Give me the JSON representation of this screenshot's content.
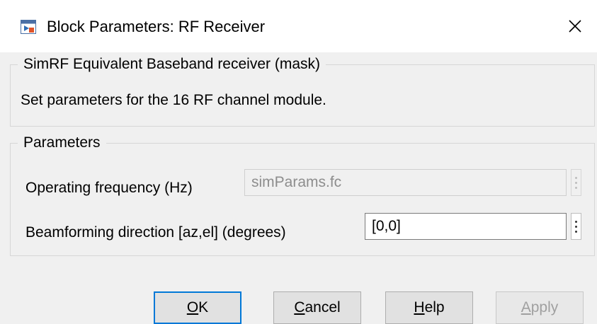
{
  "window": {
    "title": "Block Parameters: RF Receiver",
    "icon": "simulink-block-icon",
    "close_icon": "close-icon"
  },
  "mask": {
    "legend": "SimRF Equivalent Baseband receiver (mask)",
    "description": "Set parameters for the 16 RF channel module."
  },
  "parameters": {
    "legend": "Parameters",
    "operating_frequency": {
      "label": "Operating frequency (Hz)",
      "value": "simParams.fc",
      "enabled": false
    },
    "beamforming_direction": {
      "label": "Beamforming direction [az,el] (degrees)",
      "value": "[0,0]",
      "enabled": true
    }
  },
  "buttons": {
    "ok": {
      "mnemonic": "O",
      "rest": "K"
    },
    "cancel": {
      "mnemonic": "C",
      "rest": "ancel"
    },
    "help": {
      "mnemonic": "H",
      "rest": "elp"
    },
    "apply": {
      "mnemonic": "A",
      "rest": "pply",
      "enabled": false
    }
  },
  "colors": {
    "accent": "#0078d7",
    "dialog_bg": "#f0f0f0"
  }
}
